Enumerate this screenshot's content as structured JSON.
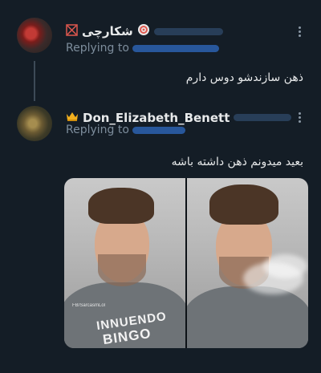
{
  "tweets": [
    {
      "author": "شکارچی",
      "reply_label": "Replying to",
      "text": "ذهن سازندشو دوس دارم"
    },
    {
      "author": "Don_Elizabeth_Benett",
      "reply_label": "Replying to",
      "text": "بعید میدونم ذهن داشته باشه"
    }
  ],
  "media": {
    "shirt_line1": "INNUENDO",
    "shirt_line2": "BINGO",
    "watermark": "FB/SarcasmLol"
  },
  "icons": {
    "crossed_icon": "crossed-box-icon",
    "target_icon": "target-icon",
    "crown_icon": "crown-icon",
    "more_icon": "more-vertical-icon"
  },
  "colors": {
    "background": "#141d26",
    "link_blue": "#1d9bf0",
    "muted": "#7d8d9c"
  }
}
